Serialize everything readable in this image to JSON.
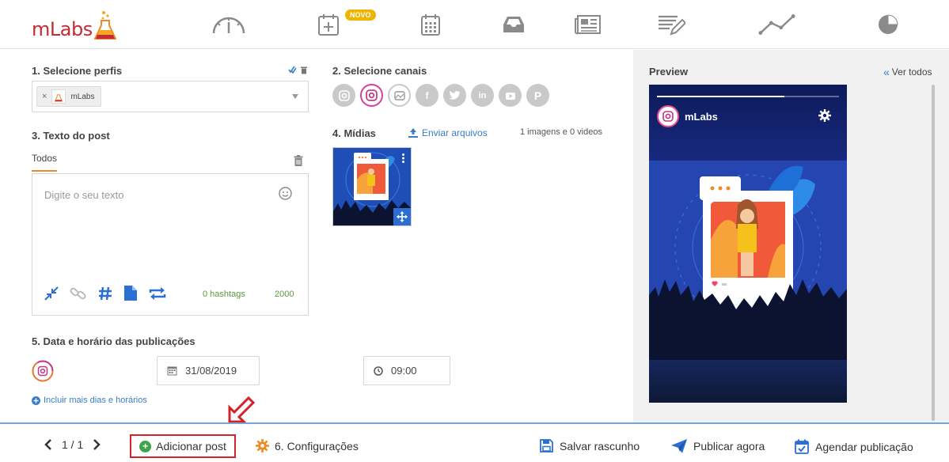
{
  "brand": {
    "name": "mLabs"
  },
  "nav": {
    "items": [
      {
        "icon": "dashboard-gauge-icon"
      },
      {
        "icon": "calendar-add-icon",
        "badge": "NOVO"
      },
      {
        "icon": "calendar-icon"
      },
      {
        "icon": "inbox-icon"
      },
      {
        "icon": "newspaper-icon"
      },
      {
        "icon": "edit-list-icon"
      },
      {
        "icon": "line-chart-icon"
      },
      {
        "icon": "pie-chart-icon"
      }
    ]
  },
  "sections": {
    "profiles_title": "1. Selecione perfis",
    "channels_title": "2. Selecione canais",
    "text_title": "3. Texto do post",
    "media_title": "4. Mídias",
    "date_title": "5. Data e horário das publicações"
  },
  "profile_select": {
    "chip_label": "mLabs",
    "chip_remove": "×"
  },
  "text_post": {
    "tab_label": "Todos",
    "placeholder": "Digite o seu texto",
    "hashtags": "0 hashtags",
    "char_count": "2000"
  },
  "media": {
    "upload_label": "Enviar arquivos",
    "count": "1 imagens e 0 videos"
  },
  "schedule": {
    "date": "31/08/2019",
    "time": "09:00",
    "more_days": "Incluir mais dias e horários"
  },
  "preview": {
    "title": "Preview",
    "see_all": "Ver todos",
    "account_name": "mLabs",
    "progress": 0.7
  },
  "bottom": {
    "pager": "1 / 1",
    "add_post": "Adicionar post",
    "settings": "6. Configurações",
    "save_draft": "Salvar rascunho",
    "publish_now": "Publicar agora",
    "schedule_post": "Agendar publicação"
  },
  "colors": {
    "accent_blue": "#3a7cc7",
    "brand_red": "#c62b35",
    "highlight_red": "#d3232a",
    "success_green": "#3ea54a",
    "tab_orange": "#f08a24"
  }
}
